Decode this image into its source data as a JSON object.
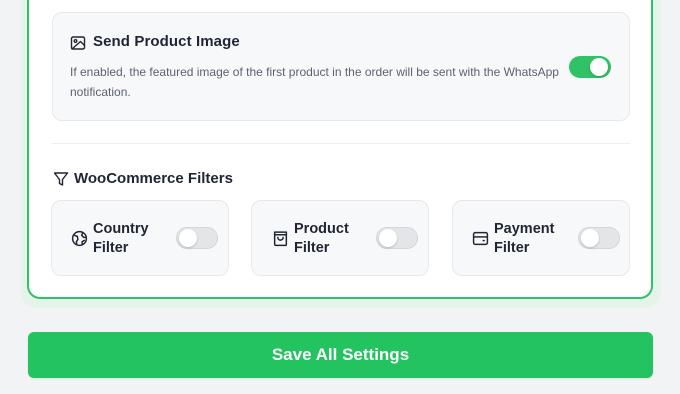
{
  "send_image": {
    "title": "Send Product Image",
    "description": "If enabled, the featured image of the first product in the order will be sent with the WhatsApp notification.",
    "icon": "image-icon",
    "enabled": true
  },
  "filters": {
    "title": "WooCommerce Filters",
    "icon": "filter-icon",
    "items": [
      {
        "line1": "Country",
        "line2": "Filter",
        "icon": "globe-icon",
        "enabled": false
      },
      {
        "line1": "Product",
        "line2": "Filter",
        "icon": "shopping-bag-icon",
        "enabled": false
      },
      {
        "line1": "Payment",
        "line2": "Filter",
        "icon": "credit-card-icon",
        "enabled": false
      }
    ]
  },
  "save_button": {
    "label": "Save All Settings"
  },
  "colors": {
    "accent": "#23c35f",
    "border": "#2fc267"
  }
}
